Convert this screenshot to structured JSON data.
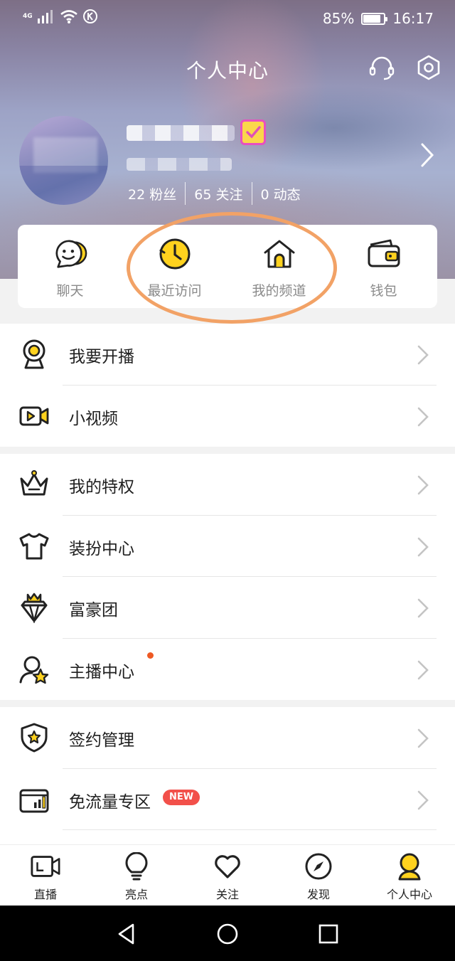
{
  "status_bar": {
    "network_label": "4G",
    "battery_percent_text": "85%",
    "battery_level": 0.85,
    "time": "16:17",
    "icons": [
      "signal-icon",
      "wifi-icon",
      "k-app-icon",
      "battery-icon"
    ]
  },
  "header": {
    "title": "个人中心",
    "icons": [
      "headset-icon",
      "settings-icon"
    ]
  },
  "profile": {
    "stats": [
      {
        "value": "22",
        "label": "粉丝"
      },
      {
        "value": "65",
        "label": "关注"
      },
      {
        "value": "0",
        "label": "动态"
      }
    ]
  },
  "quick_actions": [
    {
      "label": "聊天",
      "icon": "chat-icon"
    },
    {
      "label": "最近访问",
      "icon": "clock-icon"
    },
    {
      "label": "我的频道",
      "icon": "home-icon"
    },
    {
      "label": "钱包",
      "icon": "wallet-icon"
    }
  ],
  "menu_groups": [
    [
      {
        "label": "我要开播",
        "icon": "webcam-icon"
      },
      {
        "label": "小视频",
        "icon": "video-camera-icon"
      }
    ],
    [
      {
        "label": "我的特权",
        "icon": "crown-icon"
      },
      {
        "label": "装扮中心",
        "icon": "tshirt-icon"
      },
      {
        "label": "富豪团",
        "icon": "diamond-icon"
      },
      {
        "label": "主播中心",
        "icon": "star-user-icon",
        "has_dot": true
      }
    ],
    [
      {
        "label": "签约管理",
        "icon": "shield-star-icon"
      },
      {
        "label": "免流量专区",
        "icon": "data-card-icon",
        "badge": "NEW"
      }
    ]
  ],
  "tab_bar": [
    {
      "label": "直播",
      "icon": "live-tv-icon"
    },
    {
      "label": "亮点",
      "icon": "lightbulb-icon"
    },
    {
      "label": "关注",
      "icon": "heart-icon"
    },
    {
      "label": "发现",
      "icon": "compass-icon"
    },
    {
      "label": "个人中心",
      "icon": "person-icon",
      "active": true
    }
  ],
  "colors": {
    "accent_yellow": "#FFD21E",
    "annotation_orange": "#F2A266",
    "red_badge": "#F2504A",
    "dot_orange": "#EE5A24"
  }
}
